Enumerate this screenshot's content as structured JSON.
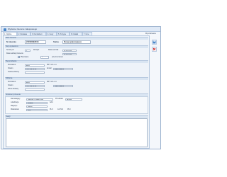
{
  "window": {
    "title": "Wydanie zlecenie zakupowego"
  },
  "tabs": [
    {
      "label": "1. Ogólne"
    },
    {
      "label": "2. Dostawa"
    },
    {
      "label": "3. Kontrahent"
    },
    {
      "label": "4. Ceny"
    },
    {
      "label": "5. Pozycje"
    },
    {
      "label": "6. Notatki"
    },
    {
      "label": "7. Inne"
    }
  ],
  "header_hint": "Wyszukiwanie",
  "form": {
    "section_main": "Dane zlecenia",
    "nr_label": "Nr zlecenia",
    "nr_value": "ZZ/0008/2016",
    "status_label": "Status",
    "status_value": "Nowe (planowane)",
    "section_dates": "Daty wydawnicze",
    "term_label": "Termin p/o",
    "term_value": "1",
    "term_unit": "Dni/tydz",
    "date_done_label": "Data real./zak.",
    "date_done_value": "01.09.2016",
    "date_plan_label": "Data realizacji zlecenia",
    "date_plan_value": "01.09.2016",
    "checkbox_label": "Planowane",
    "qty_value": "1",
    "qty_unit": "przed terminem",
    "section_buyer": "Zleceniodawca",
    "buyer_name_label": "Kontrahent",
    "buyer_name_value": "ADM",
    "buyer_nip_label": "NIP",
    "buyer_nip_value": "NIP:  ml-1-1-1",
    "buyer_phone_label": "Telefon",
    "buyer_phone_value": "(12) 234 45 59",
    "buyer_email_label": "E-mail",
    "buyer_email_value": "adm@adm.pl",
    "section_recipient": "Odbiorca",
    "rec_name_label": "Kontrahent",
    "rec_name_value": "ADM",
    "rec_nip_value": "NIP:  ml-1-1-1",
    "rec_phone_label": "Telefon",
    "rec_phone_value": "(12) 234 45 59",
    "rec_email_value": "adm@adm.pl",
    "rec_addr_label": "Osoba odbiorcy",
    "rec_addr2_label": "Adres dostawy",
    "section_contact": "Dokumenty zlecenia",
    "contact_label": "Zamawiający",
    "contact_value": "ZAKŁADY KRAKOWA",
    "contact2_label": "Przedstaw.",
    "contact2_value": "ADMIN",
    "dept_label": "Lokalizacja",
    "dept_value": "Kraków",
    "dept2_label": "AAA",
    "store_label": "Magazyn",
    "store_value": "Serwis",
    "tax_label": "Waluta/kurs",
    "tax_value": "PLN",
    "tax_extra1": "PLN",
    "tax_extra2": "A1 PLN",
    "tax_extra3": "PLN",
    "notes_label": "Uwagi"
  },
  "colors": {
    "accent": "#4a87c9",
    "danger": "#cc2a2a"
  }
}
